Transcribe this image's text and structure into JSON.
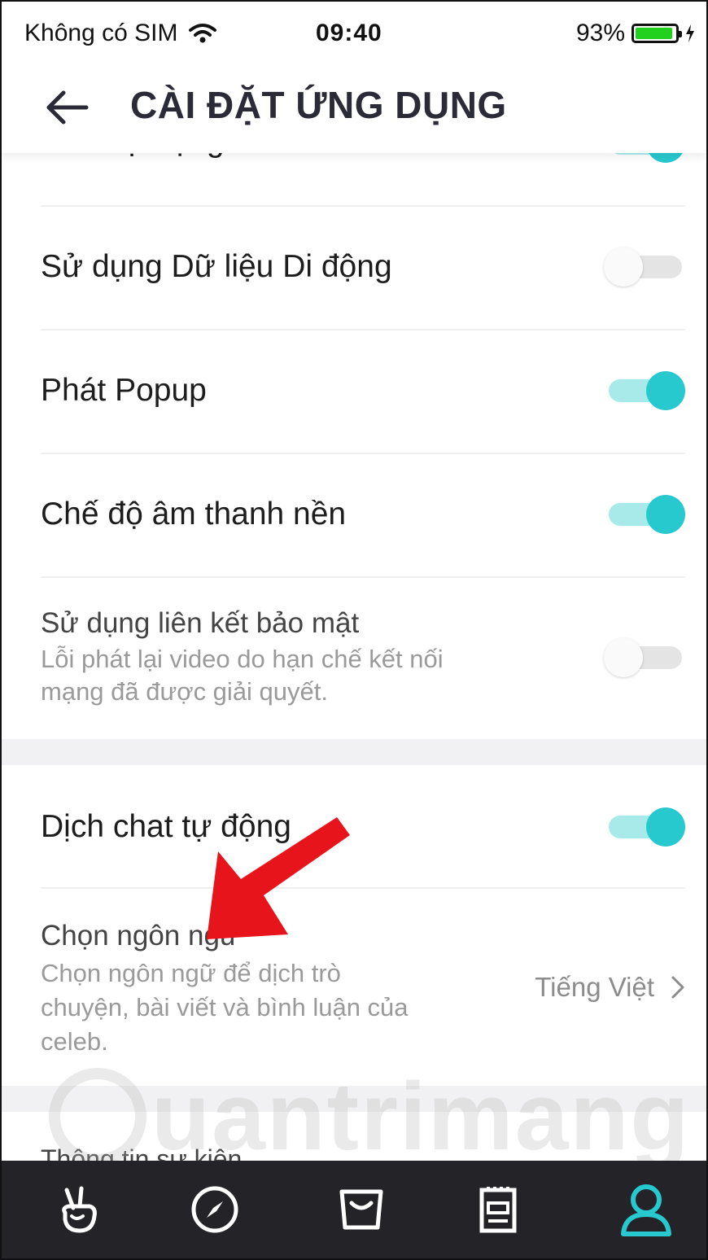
{
  "status_bar": {
    "carrier": "Không có SIM",
    "time": "09:40",
    "battery": "93%",
    "battery_level": 0.93
  },
  "header": {
    "title": "CÀI ĐẶT ỨNG DỤNG"
  },
  "settings": {
    "partial": {
      "label": "Phát tự động trên Scroll",
      "enabled": true
    },
    "mobile_data": {
      "label": "Sử dụng Dữ liệu Di động",
      "enabled": false
    },
    "popup": {
      "label": "Phát Popup",
      "enabled": true
    },
    "background_audio": {
      "label": "Chế độ âm thanh nền",
      "enabled": true
    },
    "secure_link": {
      "label": "Sử dụng liên kết bảo mật",
      "description_line1": "Lỗi phát lại video do hạn chế kết nối",
      "description_line2": "mạng đã được giải quyết.",
      "enabled": false
    },
    "auto_translate": {
      "label": "Dịch chat tự động",
      "enabled": true
    },
    "language": {
      "label": "Chọn ngôn ngữ",
      "description_line1": "Chọn ngôn ngữ để dịch trò",
      "description_line2": "chuyện, bài viết và bình luận của",
      "description_line3": "celeb.",
      "value": "Tiếng Việt"
    },
    "event_info": {
      "label": "Thông tin sự kiện"
    }
  },
  "watermark": "uantrimang",
  "colors": {
    "accent": "#27c9cf",
    "accent_track": "#a8eaea",
    "nav_bg": "#232328",
    "arrow": "#e8141b"
  },
  "bottom_nav": [
    {
      "icon": "hand-v-icon",
      "active": false
    },
    {
      "icon": "compass-icon",
      "active": false
    },
    {
      "icon": "store-icon",
      "active": false
    },
    {
      "icon": "notepad-icon",
      "active": false
    },
    {
      "icon": "profile-icon",
      "active": true
    }
  ]
}
